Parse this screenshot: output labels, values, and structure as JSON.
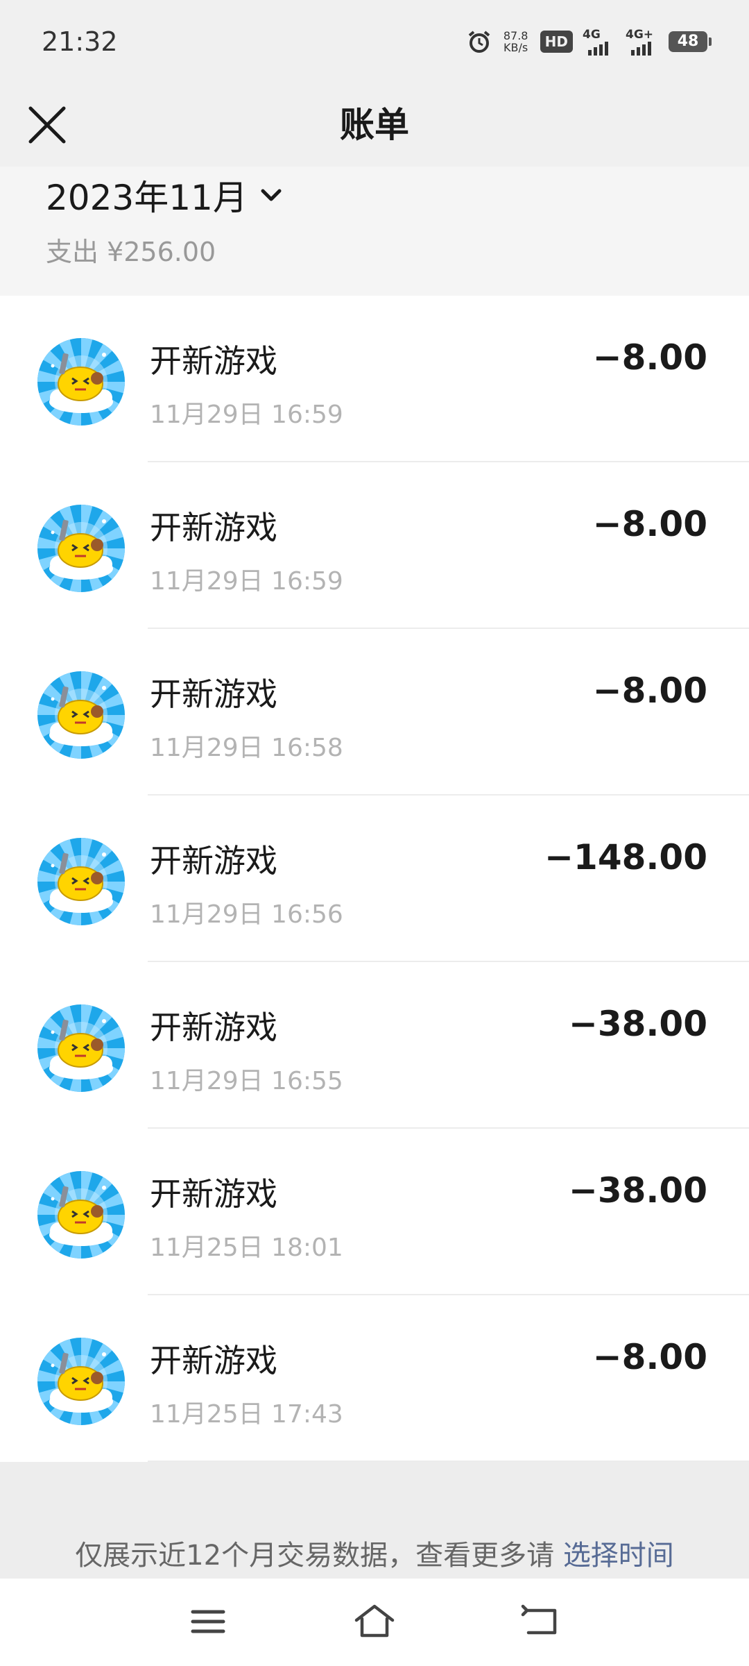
{
  "status_bar": {
    "time": "21:32",
    "net_speed_value": "87.8",
    "net_speed_unit": "KB/s",
    "hd_label": "HD",
    "sim1_label": "4G",
    "sim2_label": "4G+",
    "battery": "48"
  },
  "header": {
    "title": "账单"
  },
  "summary": {
    "month": "2023年11月",
    "expense": "支出 ¥256.00"
  },
  "transactions": [
    {
      "title": "开新游戏",
      "time": "11月29日 16:59",
      "amount": "−8.00"
    },
    {
      "title": "开新游戏",
      "time": "11月29日 16:59",
      "amount": "−8.00"
    },
    {
      "title": "开新游戏",
      "time": "11月29日 16:58",
      "amount": "−8.00"
    },
    {
      "title": "开新游戏",
      "time": "11月29日 16:56",
      "amount": "−148.00"
    },
    {
      "title": "开新游戏",
      "time": "11月29日 16:55",
      "amount": "−38.00"
    },
    {
      "title": "开新游戏",
      "time": "11月25日 18:01",
      "amount": "−38.00"
    },
    {
      "title": "开新游戏",
      "time": "11月25日 17:43",
      "amount": "−8.00"
    }
  ],
  "footer": {
    "note": "仅展示近12个月交易数据，查看更多请 ",
    "link": "选择时间"
  },
  "colors": {
    "link": "#576b95",
    "avatar_blue": "#1ea7ea",
    "avatar_yellow": "#ffd400"
  },
  "icons": {
    "close": "close-icon",
    "dropdown": "chevron-down-icon",
    "alarm": "alarm-icon",
    "menu": "menu-icon",
    "home": "home-icon",
    "back": "back-icon"
  }
}
